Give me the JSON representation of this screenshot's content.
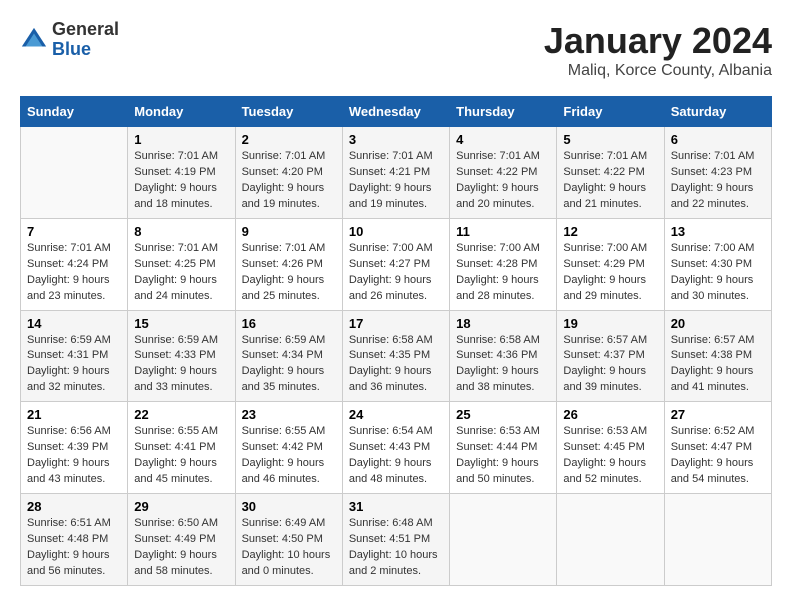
{
  "header": {
    "logo_general": "General",
    "logo_blue": "Blue",
    "month_title": "January 2024",
    "location": "Maliq, Korce County, Albania"
  },
  "weekdays": [
    "Sunday",
    "Monday",
    "Tuesday",
    "Wednesday",
    "Thursday",
    "Friday",
    "Saturday"
  ],
  "weeks": [
    [
      {
        "day": "",
        "content": ""
      },
      {
        "day": "1",
        "sunrise": "Sunrise: 7:01 AM",
        "sunset": "Sunset: 4:19 PM",
        "daylight": "Daylight: 9 hours and 18 minutes."
      },
      {
        "day": "2",
        "sunrise": "Sunrise: 7:01 AM",
        "sunset": "Sunset: 4:20 PM",
        "daylight": "Daylight: 9 hours and 19 minutes."
      },
      {
        "day": "3",
        "sunrise": "Sunrise: 7:01 AM",
        "sunset": "Sunset: 4:21 PM",
        "daylight": "Daylight: 9 hours and 19 minutes."
      },
      {
        "day": "4",
        "sunrise": "Sunrise: 7:01 AM",
        "sunset": "Sunset: 4:22 PM",
        "daylight": "Daylight: 9 hours and 20 minutes."
      },
      {
        "day": "5",
        "sunrise": "Sunrise: 7:01 AM",
        "sunset": "Sunset: 4:22 PM",
        "daylight": "Daylight: 9 hours and 21 minutes."
      },
      {
        "day": "6",
        "sunrise": "Sunrise: 7:01 AM",
        "sunset": "Sunset: 4:23 PM",
        "daylight": "Daylight: 9 hours and 22 minutes."
      }
    ],
    [
      {
        "day": "7",
        "sunrise": "Sunrise: 7:01 AM",
        "sunset": "Sunset: 4:24 PM",
        "daylight": "Daylight: 9 hours and 23 minutes."
      },
      {
        "day": "8",
        "sunrise": "Sunrise: 7:01 AM",
        "sunset": "Sunset: 4:25 PM",
        "daylight": "Daylight: 9 hours and 24 minutes."
      },
      {
        "day": "9",
        "sunrise": "Sunrise: 7:01 AM",
        "sunset": "Sunset: 4:26 PM",
        "daylight": "Daylight: 9 hours and 25 minutes."
      },
      {
        "day": "10",
        "sunrise": "Sunrise: 7:00 AM",
        "sunset": "Sunset: 4:27 PM",
        "daylight": "Daylight: 9 hours and 26 minutes."
      },
      {
        "day": "11",
        "sunrise": "Sunrise: 7:00 AM",
        "sunset": "Sunset: 4:28 PM",
        "daylight": "Daylight: 9 hours and 28 minutes."
      },
      {
        "day": "12",
        "sunrise": "Sunrise: 7:00 AM",
        "sunset": "Sunset: 4:29 PM",
        "daylight": "Daylight: 9 hours and 29 minutes."
      },
      {
        "day": "13",
        "sunrise": "Sunrise: 7:00 AM",
        "sunset": "Sunset: 4:30 PM",
        "daylight": "Daylight: 9 hours and 30 minutes."
      }
    ],
    [
      {
        "day": "14",
        "sunrise": "Sunrise: 6:59 AM",
        "sunset": "Sunset: 4:31 PM",
        "daylight": "Daylight: 9 hours and 32 minutes."
      },
      {
        "day": "15",
        "sunrise": "Sunrise: 6:59 AM",
        "sunset": "Sunset: 4:33 PM",
        "daylight": "Daylight: 9 hours and 33 minutes."
      },
      {
        "day": "16",
        "sunrise": "Sunrise: 6:59 AM",
        "sunset": "Sunset: 4:34 PM",
        "daylight": "Daylight: 9 hours and 35 minutes."
      },
      {
        "day": "17",
        "sunrise": "Sunrise: 6:58 AM",
        "sunset": "Sunset: 4:35 PM",
        "daylight": "Daylight: 9 hours and 36 minutes."
      },
      {
        "day": "18",
        "sunrise": "Sunrise: 6:58 AM",
        "sunset": "Sunset: 4:36 PM",
        "daylight": "Daylight: 9 hours and 38 minutes."
      },
      {
        "day": "19",
        "sunrise": "Sunrise: 6:57 AM",
        "sunset": "Sunset: 4:37 PM",
        "daylight": "Daylight: 9 hours and 39 minutes."
      },
      {
        "day": "20",
        "sunrise": "Sunrise: 6:57 AM",
        "sunset": "Sunset: 4:38 PM",
        "daylight": "Daylight: 9 hours and 41 minutes."
      }
    ],
    [
      {
        "day": "21",
        "sunrise": "Sunrise: 6:56 AM",
        "sunset": "Sunset: 4:39 PM",
        "daylight": "Daylight: 9 hours and 43 minutes."
      },
      {
        "day": "22",
        "sunrise": "Sunrise: 6:55 AM",
        "sunset": "Sunset: 4:41 PM",
        "daylight": "Daylight: 9 hours and 45 minutes."
      },
      {
        "day": "23",
        "sunrise": "Sunrise: 6:55 AM",
        "sunset": "Sunset: 4:42 PM",
        "daylight": "Daylight: 9 hours and 46 minutes."
      },
      {
        "day": "24",
        "sunrise": "Sunrise: 6:54 AM",
        "sunset": "Sunset: 4:43 PM",
        "daylight": "Daylight: 9 hours and 48 minutes."
      },
      {
        "day": "25",
        "sunrise": "Sunrise: 6:53 AM",
        "sunset": "Sunset: 4:44 PM",
        "daylight": "Daylight: 9 hours and 50 minutes."
      },
      {
        "day": "26",
        "sunrise": "Sunrise: 6:53 AM",
        "sunset": "Sunset: 4:45 PM",
        "daylight": "Daylight: 9 hours and 52 minutes."
      },
      {
        "day": "27",
        "sunrise": "Sunrise: 6:52 AM",
        "sunset": "Sunset: 4:47 PM",
        "daylight": "Daylight: 9 hours and 54 minutes."
      }
    ],
    [
      {
        "day": "28",
        "sunrise": "Sunrise: 6:51 AM",
        "sunset": "Sunset: 4:48 PM",
        "daylight": "Daylight: 9 hours and 56 minutes."
      },
      {
        "day": "29",
        "sunrise": "Sunrise: 6:50 AM",
        "sunset": "Sunset: 4:49 PM",
        "daylight": "Daylight: 9 hours and 58 minutes."
      },
      {
        "day": "30",
        "sunrise": "Sunrise: 6:49 AM",
        "sunset": "Sunset: 4:50 PM",
        "daylight": "Daylight: 10 hours and 0 minutes."
      },
      {
        "day": "31",
        "sunrise": "Sunrise: 6:48 AM",
        "sunset": "Sunset: 4:51 PM",
        "daylight": "Daylight: 10 hours and 2 minutes."
      },
      {
        "day": "",
        "content": ""
      },
      {
        "day": "",
        "content": ""
      },
      {
        "day": "",
        "content": ""
      }
    ]
  ]
}
